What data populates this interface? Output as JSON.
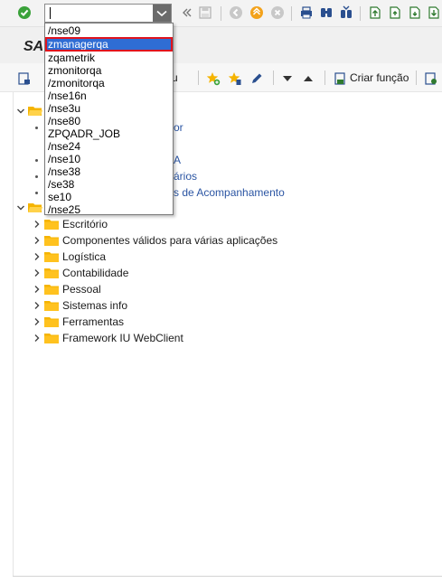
{
  "toolbar": {
    "command_field_value": "",
    "icons": [
      "enter-check-icon",
      "dropdown-chevron-icon",
      "collapse-double-chevron-icon",
      "save-icon",
      "back-icon",
      "exit-icon",
      "cancel-icon",
      "print-icon",
      "find-icon",
      "find-next-icon",
      "first-page-icon",
      "previous-page-icon",
      "next-page-icon",
      "last-page-icon"
    ]
  },
  "window": {
    "title": "SA"
  },
  "app_toolbar": {
    "menu_fragment": "u",
    "create_function_label": "Criar função"
  },
  "dropdown": {
    "items": [
      "/nse09",
      "zmanagerqa",
      "zqametrik",
      "zmonitorqa",
      "/zmonitorqa",
      "/nse16n",
      "/nse3u",
      "/nse80",
      "ZPQADR_JOB",
      "/nse24",
      "/nse10",
      "/nse38",
      "/se38",
      "se10",
      "/nse25"
    ],
    "selected_index": 1
  },
  "tree": {
    "partial_links": [
      "or",
      "A",
      "ários",
      "s de Acompanhamento"
    ],
    "folders": [
      "Escritório",
      "Componentes válidos para várias aplicações",
      "Logística",
      "Contabilidade",
      "Pessoal",
      "Sistemas info",
      "Ferramentas",
      "Framework IU WebClient"
    ]
  },
  "colors": {
    "selection_blue": "#2f6dd4",
    "selection_outline_red": "#e0141e",
    "link_blue": "#2b55a3",
    "folder_yellow": "#f5b400",
    "check_green": "#3aa23a"
  }
}
